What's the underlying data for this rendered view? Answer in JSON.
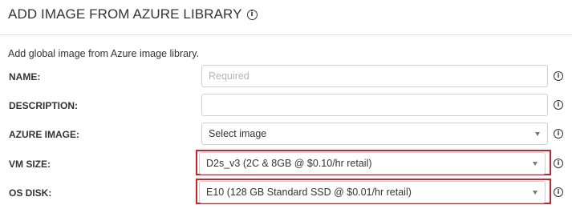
{
  "header": {
    "title": "ADD IMAGE FROM AZURE LIBRARY",
    "title_icon": "info-icon"
  },
  "subtitle": "Add global image from Azure image library.",
  "form": {
    "name": {
      "label": "NAME:",
      "placeholder": "Required",
      "value": ""
    },
    "description": {
      "label": "DESCRIPTION:",
      "placeholder": "",
      "value": ""
    },
    "azure_image": {
      "label": "AZURE IMAGE:",
      "selected": "Select image"
    },
    "vm_size": {
      "label": "VM SIZE:",
      "selected": "D2s_v3 (2C & 8GB @ $0.10/hr retail)",
      "highlighted": true
    },
    "os_disk": {
      "label": "OS DISK:",
      "selected": "E10 (128 GB Standard SSD @ $0.01/hr retail)",
      "highlighted": true
    }
  },
  "colors": {
    "highlight": "#d0202b",
    "border": "#cfcfcf",
    "text": "#333333"
  }
}
